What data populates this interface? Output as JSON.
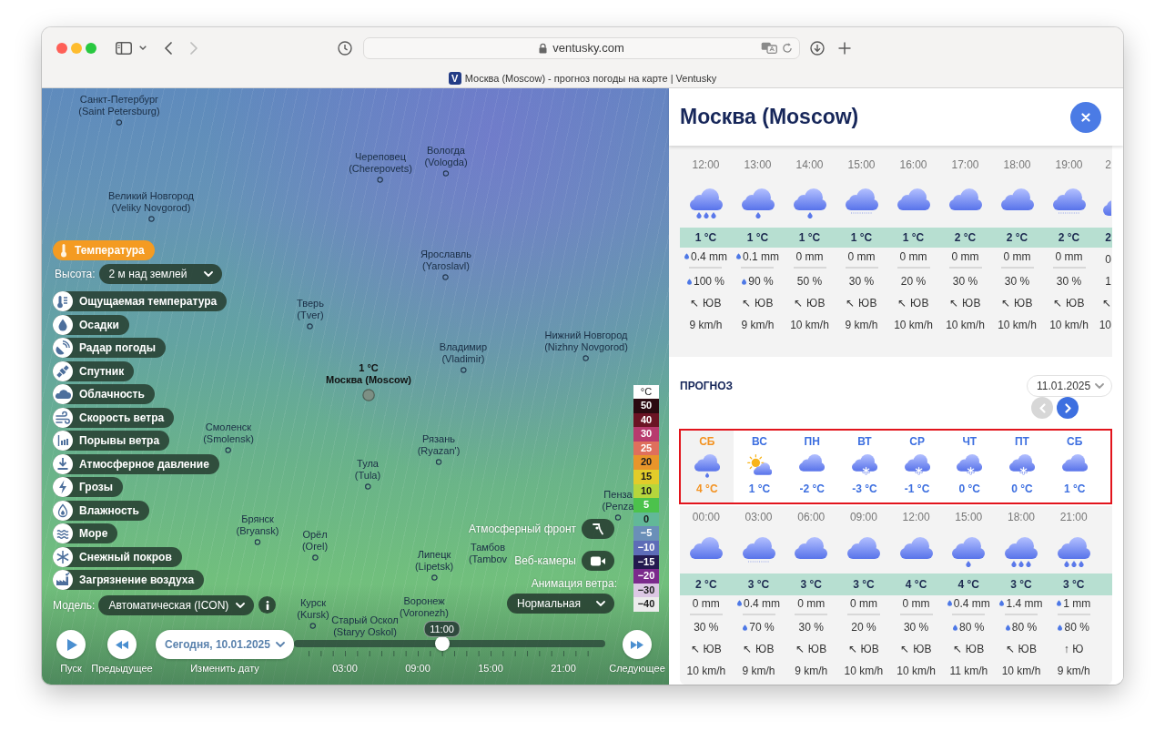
{
  "browser": {
    "nav": [
      {
        "kind": "back",
        "disabled": false
      },
      {
        "kind": "forward",
        "disabled": true
      }
    ],
    "url": "ventusky.com",
    "tab": {
      "icon_letter": "V",
      "title": "Москва (Moscow) - прогноз погоды на карте | Ventusky"
    }
  },
  "map": {
    "cities": [
      {
        "name": "Санкт-Петербург",
        "latin": "(Saint Petersburg)",
        "marker": true
      },
      {
        "name": "Вологда",
        "latin": "(Vologda)",
        "marker": true
      },
      {
        "name": "Череповец",
        "latin": "(Cherepovets)",
        "marker": true
      },
      {
        "name": "Великий Новгород",
        "latin": "(Veliky Novgorod)",
        "marker": true
      },
      {
        "name": "Ярославль",
        "latin": "(Yaroslavl)",
        "marker": true
      },
      {
        "name": "Тверь",
        "latin": "(Tver)",
        "marker": true
      },
      {
        "name": "Нижний Новгород",
        "latin": "(Nizhny Novgorod)",
        "marker": true
      },
      {
        "name": "Владимир",
        "latin": "(Vladimir)",
        "marker": true
      },
      {
        "name": "Смоленск",
        "latin": "(Smolensk)",
        "marker": true
      },
      {
        "name": "Рязань",
        "latin": "(Ryazan')",
        "marker": true
      },
      {
        "name": "Тула",
        "latin": "(Tula)",
        "marker": true
      },
      {
        "name": "Брянск",
        "latin": "(Bryansk)",
        "marker": true
      },
      {
        "name": "Пенза",
        "latin": "(Penza",
        "marker": true
      },
      {
        "name": "Орёл",
        "latin": "(Orel)",
        "marker": true
      },
      {
        "name": "Тамбов",
        "latin": "(Tambov",
        "marker": false
      },
      {
        "name": "Липецк",
        "latin": "(Lipetsk)",
        "marker": true
      },
      {
        "name": "Курск",
        "latin": "(Kursk)",
        "marker": true
      },
      {
        "name": "Воронеж",
        "latin": "(Voronezh)",
        "marker": false
      },
      {
        "name": "Старый Оскол",
        "latin": "(Staryy Oskol)",
        "marker": false
      }
    ],
    "location": {
      "temp": "1 °C",
      "name": "Москва (Moscow)"
    },
    "layers": [
      {
        "label": "Температура",
        "selected": true
      },
      {
        "label": "Ощущаемая температура",
        "selected": false
      },
      {
        "label": "Осадки",
        "selected": false
      },
      {
        "label": "Радар погоды",
        "selected": false
      },
      {
        "label": "Спутник",
        "selected": false
      },
      {
        "label": "Облачность",
        "selected": false
      },
      {
        "label": "Скорость ветра",
        "selected": false
      },
      {
        "label": "Порывы ветра",
        "selected": false
      },
      {
        "label": "Атмосферное давление",
        "selected": false
      },
      {
        "label": "Грозы",
        "selected": false
      },
      {
        "label": "Влажность",
        "selected": false
      },
      {
        "label": "Море",
        "selected": false
      },
      {
        "label": "Снежный покров",
        "selected": false
      },
      {
        "label": "Загрязнение воздуха",
        "selected": false
      }
    ],
    "altitude": {
      "label": "Высота:",
      "value": "2 м над землей"
    },
    "model": {
      "label": "Модель:",
      "value": "Автоматическая (ICON)"
    },
    "toggles": [
      {
        "kind": "front",
        "label": "Атмосферный фронт"
      },
      {
        "kind": "webcam",
        "label": "Веб-камеры"
      }
    ],
    "wind_animation": {
      "label": "Анимация ветра:",
      "value": "Нормальная"
    },
    "legend": {
      "unit": "°C",
      "items": [
        {
          "label": "50",
          "color": "#2a0a10"
        },
        {
          "label": "40",
          "color": "#6b1424"
        },
        {
          "label": "30",
          "color": "#b83a6e"
        },
        {
          "label": "25",
          "color": "#df6f5c"
        },
        {
          "label": "20",
          "color": "#e8952a"
        },
        {
          "label": "15",
          "color": "#e2cc2a"
        },
        {
          "label": "10",
          "color": "#b6d63c"
        },
        {
          "label": "5",
          "color": "#4cc24c"
        },
        {
          "label": "0",
          "color": "#62b898"
        },
        {
          "label": "−5",
          "color": "#6a8fb8"
        },
        {
          "label": "−10",
          "color": "#5d6cb7"
        },
        {
          "label": "−15",
          "color": "#231a4f"
        },
        {
          "label": "−20",
          "color": "#7b2a8c"
        },
        {
          "label": "−30",
          "color": "#dcc8e4"
        },
        {
          "label": "−40",
          "color": "#ececec"
        }
      ]
    },
    "timeline": {
      "play": "Пуск",
      "previous": "Предыдущее",
      "date": "Сегодня, 10.01.2025",
      "date_hint": "Изменить дату",
      "time": "11:00",
      "level": 0.458,
      "ticks": [
        "03:00",
        "09:00",
        "15:00",
        "21:00"
      ],
      "next": "Следующее"
    }
  },
  "detail": {
    "title": "Москва (Moscow)",
    "hourly": [
      {
        "time": "12:00",
        "kind": "rain",
        "temp": "1 °C",
        "precip": "0.4 mm",
        "precip_mark": true,
        "chance": "100 %",
        "chance_mark": true,
        "wind": "↖ ЮВ",
        "speed": "9 km/h"
      },
      {
        "time": "13:00",
        "kind": "light-rain",
        "temp": "1 °C",
        "precip": "0.1 mm",
        "precip_mark": true,
        "chance": "90 %",
        "chance_mark": true,
        "wind": "↖ ЮВ",
        "speed": "9 km/h"
      },
      {
        "time": "14:00",
        "kind": "light-rain",
        "temp": "1 °C",
        "precip": "0 mm",
        "precip_mark": false,
        "chance": "50 %",
        "chance_mark": false,
        "wind": "↖ ЮВ",
        "speed": "10 km/h"
      },
      {
        "time": "15:00",
        "kind": "drizzle",
        "temp": "1 °C",
        "precip": "0 mm",
        "precip_mark": false,
        "chance": "30 %",
        "chance_mark": false,
        "wind": "↖ ЮВ",
        "speed": "9 km/h"
      },
      {
        "time": "16:00",
        "kind": "cloudy",
        "temp": "1 °C",
        "precip": "0 mm",
        "precip_mark": false,
        "chance": "20 %",
        "chance_mark": false,
        "wind": "↖ ЮВ",
        "speed": "10 km/h"
      },
      {
        "time": "17:00",
        "kind": "cloudy",
        "temp": "2 °C",
        "precip": "0 mm",
        "precip_mark": false,
        "chance": "30 %",
        "chance_mark": false,
        "wind": "↖ ЮВ",
        "speed": "10 km/h"
      },
      {
        "time": "18:00",
        "kind": "cloudy",
        "temp": "2 °C",
        "precip": "0 mm",
        "precip_mark": false,
        "chance": "30 %",
        "chance_mark": false,
        "wind": "↖ ЮВ",
        "speed": "10 km/h"
      },
      {
        "time": "19:00",
        "kind": "drizzle",
        "temp": "2 °C",
        "precip": "0 mm",
        "precip_mark": false,
        "chance": "30 %",
        "chance_mark": false,
        "wind": "↖ ЮВ",
        "speed": "10 km/h"
      }
    ],
    "hourly_partial": {
      "time": "2",
      "temp": "2",
      "precip": "0",
      "chance": "1",
      "wind": "↖",
      "speed": "10"
    },
    "forecast": {
      "heading": "ПРОГНОЗ",
      "date": "11.01.2025",
      "nav": [
        {
          "kind": "previous",
          "disabled": true
        },
        {
          "kind": "next",
          "disabled": false
        }
      ],
      "days": [
        {
          "day": "СБ",
          "kind": "light-rain",
          "temp": "4 °C",
          "selected": true
        },
        {
          "day": "ВС",
          "kind": "sun-cloud",
          "temp": "1 °C",
          "selected": false
        },
        {
          "day": "ПН",
          "kind": "cloudy",
          "temp": "-2 °C",
          "selected": false
        },
        {
          "day": "ВТ",
          "kind": "snow",
          "temp": "-3 °C",
          "selected": false
        },
        {
          "day": "СР",
          "kind": "snow",
          "temp": "-1 °C",
          "selected": false
        },
        {
          "day": "ЧТ",
          "kind": "snow",
          "temp": "0 °C",
          "selected": false
        },
        {
          "day": "ПТ",
          "kind": "snow",
          "temp": "0 °C",
          "selected": false
        },
        {
          "day": "СБ",
          "kind": "cloudy",
          "temp": "1 °C",
          "selected": false
        }
      ],
      "periods": [
        {
          "time": "00:00",
          "kind": "cloudy",
          "temp": "2 °C",
          "precip": "0 mm",
          "precip_mark": false,
          "chance": "30 %",
          "chance_mark": false,
          "wind": "↖ ЮВ",
          "speed": "10 km/h"
        },
        {
          "time": "03:00",
          "kind": "drizzle",
          "temp": "3 °C",
          "precip": "0.4 mm",
          "precip_mark": true,
          "chance": "70 %",
          "chance_mark": true,
          "wind": "↖ ЮВ",
          "speed": "9 km/h"
        },
        {
          "time": "06:00",
          "kind": "cloudy",
          "temp": "3 °C",
          "precip": "0 mm",
          "precip_mark": false,
          "chance": "30 %",
          "chance_mark": false,
          "wind": "↖ ЮВ",
          "speed": "9 km/h"
        },
        {
          "time": "09:00",
          "kind": "cloudy",
          "temp": "3 °C",
          "precip": "0 mm",
          "precip_mark": false,
          "chance": "20 %",
          "chance_mark": false,
          "wind": "↖ ЮВ",
          "speed": "10 km/h"
        },
        {
          "time": "12:00",
          "kind": "cloudy",
          "temp": "4 °C",
          "precip": "0 mm",
          "precip_mark": false,
          "chance": "30 %",
          "chance_mark": false,
          "wind": "↖ ЮВ",
          "speed": "10 km/h"
        },
        {
          "time": "15:00",
          "kind": "light-rain",
          "temp": "4 °C",
          "precip": "0.4 mm",
          "precip_mark": true,
          "chance": "80 %",
          "chance_mark": true,
          "wind": "↖ ЮВ",
          "speed": "11 km/h"
        },
        {
          "time": "18:00",
          "kind": "rain",
          "temp": "3 °C",
          "precip": "1.4 mm",
          "precip_mark": true,
          "chance": "80 %",
          "chance_mark": true,
          "wind": "↖ ЮВ",
          "speed": "10 km/h"
        },
        {
          "time": "21:00",
          "kind": "rain",
          "temp": "3 °C",
          "precip": "1 mm",
          "precip_mark": true,
          "chance": "80 %",
          "chance_mark": true,
          "wind": "↑ Ю",
          "speed": "9 km/h"
        }
      ]
    }
  }
}
